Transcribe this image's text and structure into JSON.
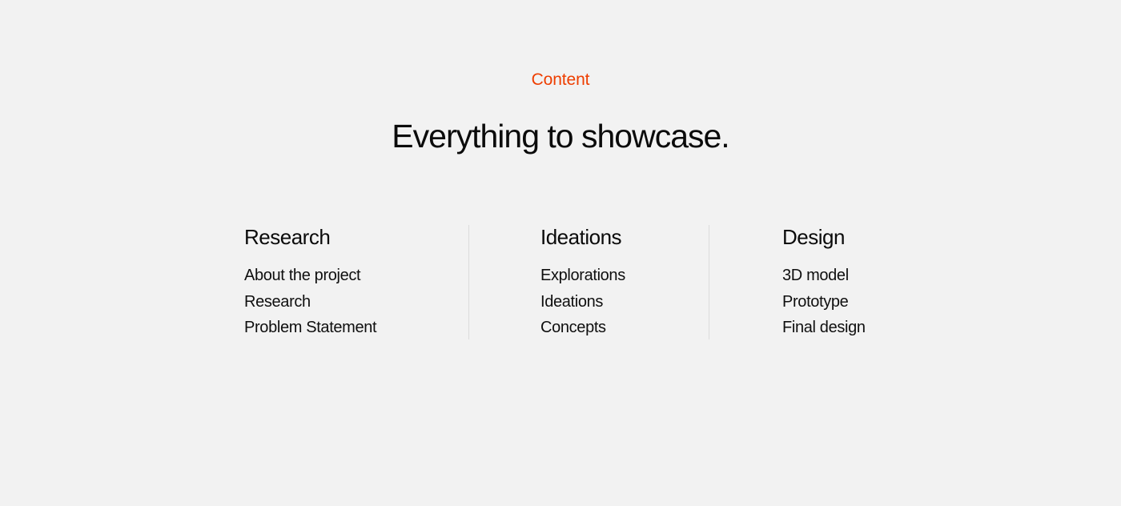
{
  "page": {
    "background_color": "#f2f2f2",
    "text_color": "#0b0b0b"
  },
  "header": {
    "eyebrow": "Content",
    "eyebrow_color": "#ee3e00",
    "headline": "Everything to showcase."
  },
  "columns": [
    {
      "heading": "Research",
      "items": [
        "About the project",
        "Research",
        "Problem Statement"
      ]
    },
    {
      "heading": "Ideations",
      "items": [
        "Explorations",
        "Ideations",
        "Concepts"
      ]
    },
    {
      "heading": "Design",
      "items": [
        "3D model",
        "Prototype",
        "Final design"
      ]
    }
  ],
  "dividers": {
    "color": "#dcdcdc",
    "count": 2
  }
}
